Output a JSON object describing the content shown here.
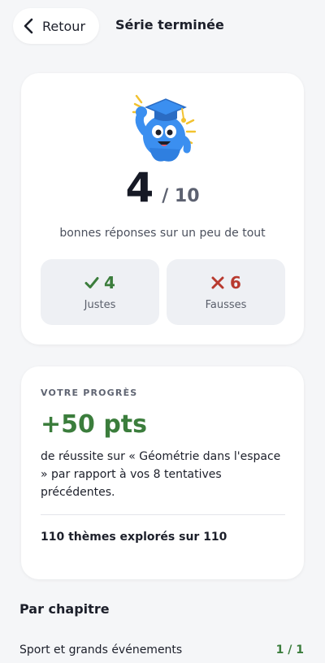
{
  "header": {
    "back_label": "Retour",
    "title": "Série terminée"
  },
  "score_card": {
    "score": "4",
    "total": "/ 10",
    "caption": "bonnes réponses sur un peu de tout",
    "correct": {
      "count": "4",
      "label": "Justes",
      "icon": "check-icon",
      "color": "#3b7d3c"
    },
    "wrong": {
      "count": "6",
      "label": "Fausses",
      "icon": "cross-icon",
      "color": "#b83a2f"
    },
    "mascot": "graduate-mascot"
  },
  "progress": {
    "heading": "VOTRE PROGRÈS",
    "points": "+50 pts",
    "description": "de réussite sur « Géométrie dans l'espace » par rapport à vos 8 tentatives précédentes.",
    "themes": "110 thèmes explorés sur 110"
  },
  "chapters": {
    "title": "Par chapitre",
    "items": [
      {
        "name": "Sport et grands événements",
        "score": "1 / 1"
      }
    ]
  },
  "colors": {
    "background": "#f5f6f8",
    "card": "#ffffff",
    "success": "#3b7d3c",
    "error": "#b83a2f",
    "mascot_blue": "#3b8ff0"
  }
}
